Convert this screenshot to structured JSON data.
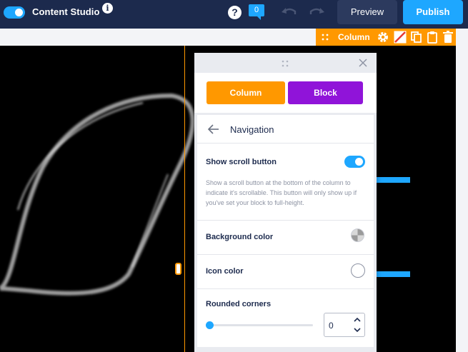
{
  "app": {
    "title": "Content Studio",
    "info_icon": "info-icon",
    "help_icon": "help-icon",
    "notification_count": "0",
    "undo_icon": "undo-icon",
    "redo_icon": "redo-icon",
    "preview_label": "Preview",
    "publish_label": "Publish",
    "accent_color": "#1ea7ff",
    "header_color": "#1c2a4d"
  },
  "column_toolbar": {
    "label": "Column",
    "color": "#ff9800",
    "icons": [
      "drag-handle-icon",
      "gear-icon",
      "no-fill-icon",
      "copy-icon",
      "paste-icon",
      "trash-icon"
    ]
  },
  "panel": {
    "tabs": {
      "column": "Column",
      "block": "Block",
      "column_color": "#ff9800",
      "block_color": "#9014d9"
    },
    "section_title": "Navigation",
    "show_scroll_button": {
      "label": "Show scroll button",
      "enabled": true,
      "description": "Show a scroll button at the bottom of the column to indicate it's scrollable. This button will only show up if you've set your block to full-height."
    },
    "background_color": {
      "label": "Background color"
    },
    "icon_color": {
      "label": "Icon color"
    },
    "rounded_corners": {
      "label": "Rounded corners",
      "value": "0",
      "slider_fraction": 0
    }
  }
}
